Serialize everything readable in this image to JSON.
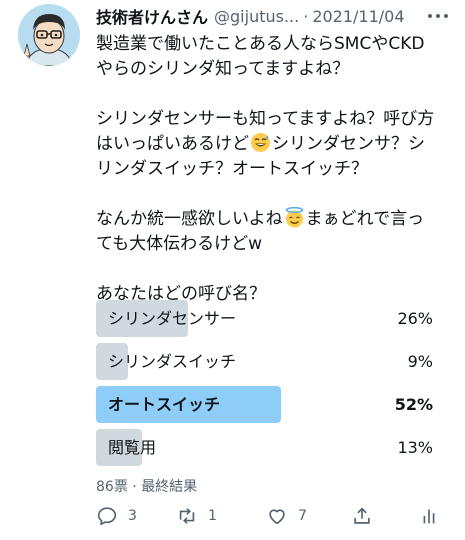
{
  "tweet": {
    "display_name": "技術者けんさん",
    "handle": "@gijutus...",
    "separator": "·",
    "date": "2021/11/04",
    "body": {
      "p1_line1": "製造業で働いたことある人ならSMCやCKD",
      "p1_line2": "やらのシリンダ知ってますよね？",
      "p2_line1": "シリンダセンサーも知ってますよね？呼び方",
      "p2_line2a": "はいっぱいあるけど",
      "p2_line2b": "シリンダセンサ？シ",
      "p2_line3": "リンダスイッチ？オートスイッチ？",
      "p3_line1a": "なんか統一感欲しいよね",
      "p3_line1b": "まぁどれで言っ",
      "p3_line2": "ても大体伝わるけどw",
      "p4_line1": "あなたはどの呼び名？"
    },
    "emoji": {
      "p2": "grinning-face-with-sweat-emoji",
      "p3": "smiling-face-with-halo-emoji"
    }
  },
  "poll": {
    "options": [
      {
        "label": "シリンダセンサー",
        "percent": "26%",
        "fraction": 0.26
      },
      {
        "label": "シリンダスイッチ",
        "percent": "9%",
        "fraction": 0.09
      },
      {
        "label": "オートスイッチ",
        "percent": "52%",
        "fraction": 0.52,
        "winner": true
      },
      {
        "label": "閲覧用",
        "percent": "13%",
        "fraction": 0.13
      }
    ],
    "votes": "86票",
    "separator": "·",
    "status": "最終結果"
  },
  "actions": {
    "reply_count": "3",
    "retweet_count": "1",
    "like_count": "7"
  },
  "colors": {
    "bar": "#cfd9de",
    "winner_bar": "#8ecdf8",
    "secondary_text": "#536471"
  }
}
